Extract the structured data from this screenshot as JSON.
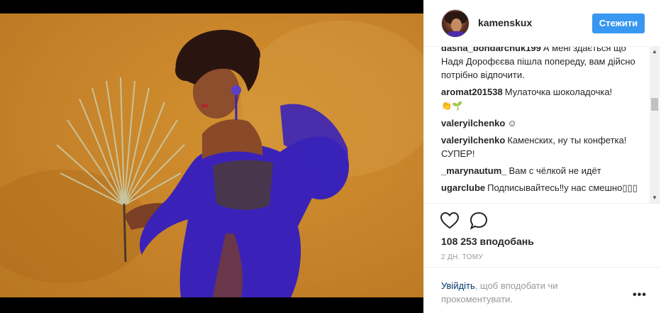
{
  "post": {
    "username": "kamenskux",
    "follow_label": "Стежити",
    "photo_alt_icon": "post-photo"
  },
  "comments": [
    {
      "user": "dasha_bondarchuk199",
      "text": "А мені здається що Надя Дорофєєва пішла попереду, вам дійсно потрібно відпочити."
    },
    {
      "user": "aromat201538",
      "text": "Мулаточка шоколадочка!",
      "emoji": "👏🌱"
    },
    {
      "user": "valeryilchenko",
      "text": "☺"
    },
    {
      "user": "valeryilchenko",
      "text": "Каменских, ну ты конфетка! СУПЕР!"
    },
    {
      "user": "_marynautum_",
      "text": "Вам с чёлкой не идёт"
    },
    {
      "user": "ugarclube",
      "text": "Подписывайтесь‼у нас смешно▯▯▯"
    }
  ],
  "actions": {
    "likes_text": "108 253 вподобань",
    "timestamp": "2 дн. тому"
  },
  "footer": {
    "login_link": "Увійдіть",
    "login_rest": ", щоб вподобати чи прокоментувати.",
    "more_label": "•••"
  },
  "colors": {
    "accent": "#3897f0",
    "link": "#003569",
    "muted": "#999999",
    "dress": "#3a22b8",
    "wall": "#c9862b"
  }
}
